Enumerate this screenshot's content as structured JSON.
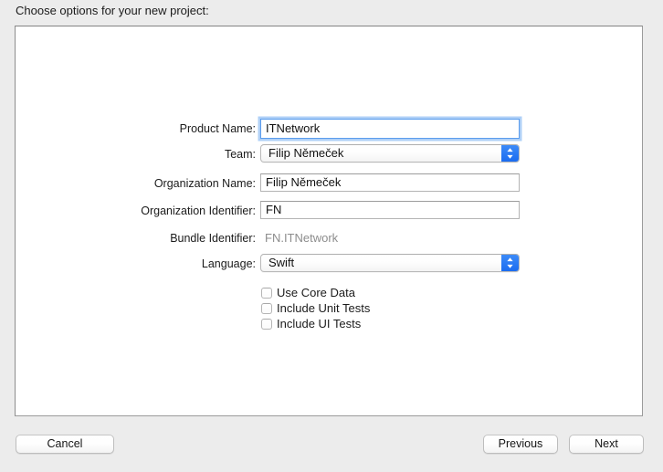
{
  "dialog": {
    "title": "Choose options for your new project:"
  },
  "form": {
    "fields": [
      {
        "label": "Product Name:",
        "value": "ITNetwork",
        "type": "text-field",
        "focused": true
      },
      {
        "label": "Team:",
        "value": "Filip Němeček",
        "type": "popup-button",
        "focused": false
      },
      {
        "label": "Organization Name:",
        "value": "Filip Němeček",
        "type": "text-field",
        "focused": false
      },
      {
        "label": "Organization Identifier:",
        "value": "FN",
        "type": "text-field",
        "focused": false
      },
      {
        "label": "Bundle Identifier:",
        "value": "FN.ITNetwork",
        "type": "static-text",
        "focused": false
      },
      {
        "label": "Language:",
        "value": "Swift",
        "type": "popup-button",
        "focused": false
      }
    ],
    "checkboxes": [
      {
        "label": "Use Core Data",
        "checked": false
      },
      {
        "label": "Include Unit Tests",
        "checked": false
      },
      {
        "label": "Include UI Tests",
        "checked": false
      }
    ]
  },
  "buttons": {
    "cancel": "Cancel",
    "previous": "Previous",
    "next": "Next"
  },
  "icons": {
    "popup_arrows": "up-down-chevron-icon"
  },
  "colors": {
    "window_background": "#ececec",
    "panel_background": "#ffffff",
    "panel_border": "#9b9b9b",
    "focus_ring": "#5a9ced",
    "popup_accent": "#1a6cf0",
    "disabled_text": "#8d8d8d",
    "text": "#1b1b1b"
  }
}
